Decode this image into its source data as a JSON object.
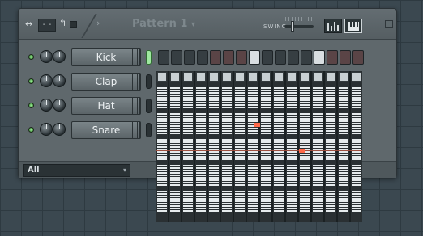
{
  "window": {
    "pattern_title": "Pattern 1",
    "pattern_arrow": "▾",
    "swing_label": "SWING",
    "dash_button": "- -",
    "arrows_icon": "↔",
    "undo_icon": "↰",
    "chevron_icon": "›"
  },
  "channels": [
    {
      "name": "Kick",
      "selected": true
    },
    {
      "name": "Clap",
      "selected": false
    },
    {
      "name": "Hat",
      "selected": false
    },
    {
      "name": "Snare",
      "selected": false
    }
  ],
  "steps": {
    "count": 16,
    "lit": [
      7,
      12
    ],
    "colors": {
      "dark": "#363e42",
      "red": "#5a4446",
      "lit": "#d9dee1"
    }
  },
  "filter": {
    "value": "All",
    "arrow": "▾"
  },
  "colors": {
    "accent_highlight": "#ff6a4a",
    "led_green": "#7ddc7a"
  }
}
